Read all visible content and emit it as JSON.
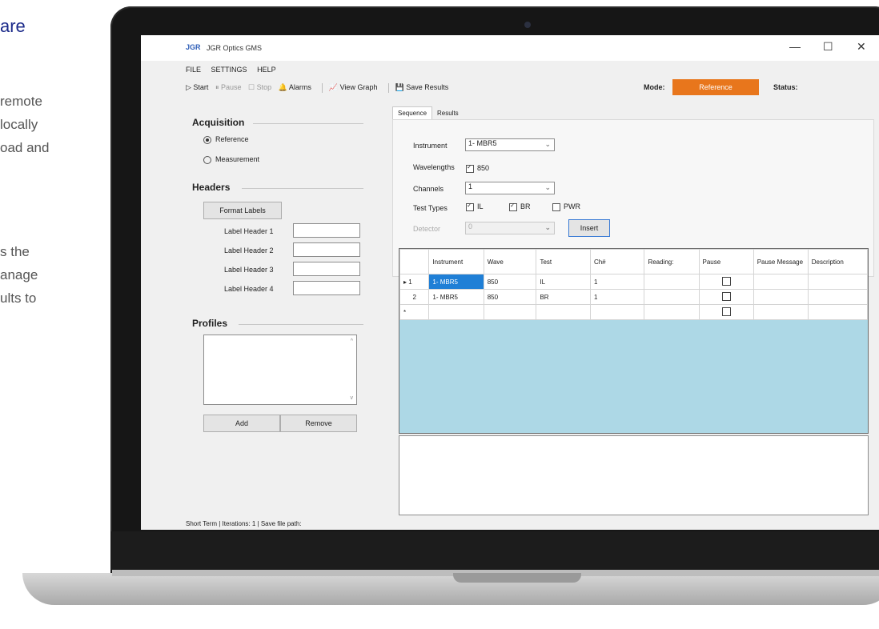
{
  "marketing": {
    "heading_fragment": "are",
    "lines": [
      "remote",
      "locally",
      "oad and",
      "s the",
      "anage",
      "ults to"
    ]
  },
  "window": {
    "logo": "JGR",
    "title": "JGR Optics GMS",
    "controls": {
      "minimize": "—",
      "maximize": "☐",
      "close": "✕"
    }
  },
  "menu": [
    "FILE",
    "SETTINGS",
    "HELP"
  ],
  "toolbar": {
    "start": "▷ Start",
    "pause": "⏸ Pause",
    "stop": "☐ Stop",
    "alarms": "🔔 Alarms",
    "view_graph": "View Graph",
    "save_results": "Save Results",
    "mode_label": "Mode:",
    "mode_value": "Reference",
    "status_label": "Status:",
    "mode_color": "#e8761c"
  },
  "acquisition": {
    "title": "Acquisition",
    "options": [
      {
        "label": "Reference",
        "selected": true
      },
      {
        "label": "Measurement",
        "selected": false
      }
    ]
  },
  "headers": {
    "title": "Headers",
    "format_button": "Format Labels",
    "labels": [
      "Label Header 1",
      "Label Header 2",
      "Label Header 3",
      "Label Header 4"
    ]
  },
  "profiles": {
    "title": "Profiles",
    "add_button": "Add",
    "remove_button": "Remove"
  },
  "tabs": [
    "Sequence",
    "Results"
  ],
  "sequence": {
    "instrument_label": "Instrument",
    "instrument_value": "1- MBR5",
    "wavelengths_label": "Wavelengths",
    "wavelength_850": "850",
    "channels_label": "Channels",
    "channels_value": "1",
    "test_types_label": "Test Types",
    "test_types": [
      {
        "label": "IL",
        "checked": true
      },
      {
        "label": "BR",
        "checked": true
      },
      {
        "label": "PWR",
        "checked": false
      }
    ],
    "detector_label": "Detector",
    "detector_value": "0",
    "insert_button": "Insert"
  },
  "grid": {
    "columns": [
      "Instrument",
      "Wave",
      "Test",
      "Ch#",
      "Reading:",
      "Pause",
      "Pause Message",
      "Description"
    ],
    "rows": [
      {
        "header": "▸ 1",
        "instrument": "1- MBR5",
        "wave": "850",
        "test": "IL",
        "ch": "1"
      },
      {
        "header": "2",
        "instrument": "1- MBR5",
        "wave": "850",
        "test": "BR",
        "ch": "1"
      },
      {
        "header": "*",
        "instrument": "",
        "wave": "",
        "test": "",
        "ch": ""
      }
    ],
    "background": "#add8e6"
  },
  "statusbar": "Short Term | Iterations: 1 | Save file path:"
}
